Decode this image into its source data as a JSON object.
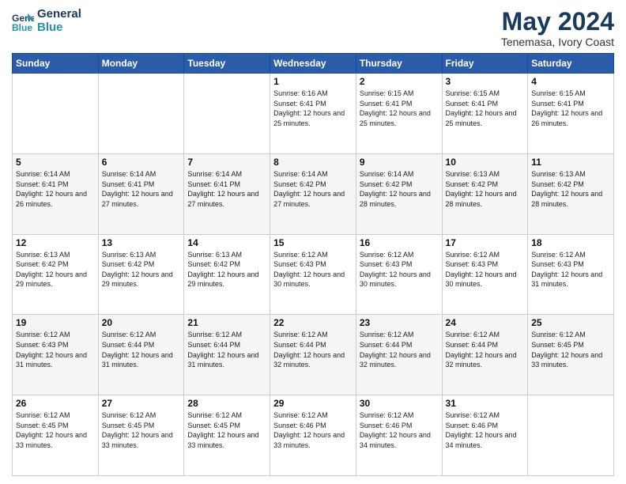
{
  "header": {
    "logo_line1": "General",
    "logo_line2": "Blue",
    "month_year": "May 2024",
    "location": "Tenemasa, Ivory Coast"
  },
  "days_of_week": [
    "Sunday",
    "Monday",
    "Tuesday",
    "Wednesday",
    "Thursday",
    "Friday",
    "Saturday"
  ],
  "weeks": [
    [
      {
        "num": "",
        "info": ""
      },
      {
        "num": "",
        "info": ""
      },
      {
        "num": "",
        "info": ""
      },
      {
        "num": "1",
        "info": "Sunrise: 6:16 AM\nSunset: 6:41 PM\nDaylight: 12 hours\nand 25 minutes."
      },
      {
        "num": "2",
        "info": "Sunrise: 6:15 AM\nSunset: 6:41 PM\nDaylight: 12 hours\nand 25 minutes."
      },
      {
        "num": "3",
        "info": "Sunrise: 6:15 AM\nSunset: 6:41 PM\nDaylight: 12 hours\nand 25 minutes."
      },
      {
        "num": "4",
        "info": "Sunrise: 6:15 AM\nSunset: 6:41 PM\nDaylight: 12 hours\nand 26 minutes."
      }
    ],
    [
      {
        "num": "5",
        "info": "Sunrise: 6:14 AM\nSunset: 6:41 PM\nDaylight: 12 hours\nand 26 minutes."
      },
      {
        "num": "6",
        "info": "Sunrise: 6:14 AM\nSunset: 6:41 PM\nDaylight: 12 hours\nand 27 minutes."
      },
      {
        "num": "7",
        "info": "Sunrise: 6:14 AM\nSunset: 6:41 PM\nDaylight: 12 hours\nand 27 minutes."
      },
      {
        "num": "8",
        "info": "Sunrise: 6:14 AM\nSunset: 6:42 PM\nDaylight: 12 hours\nand 27 minutes."
      },
      {
        "num": "9",
        "info": "Sunrise: 6:14 AM\nSunset: 6:42 PM\nDaylight: 12 hours\nand 28 minutes."
      },
      {
        "num": "10",
        "info": "Sunrise: 6:13 AM\nSunset: 6:42 PM\nDaylight: 12 hours\nand 28 minutes."
      },
      {
        "num": "11",
        "info": "Sunrise: 6:13 AM\nSunset: 6:42 PM\nDaylight: 12 hours\nand 28 minutes."
      }
    ],
    [
      {
        "num": "12",
        "info": "Sunrise: 6:13 AM\nSunset: 6:42 PM\nDaylight: 12 hours\nand 29 minutes."
      },
      {
        "num": "13",
        "info": "Sunrise: 6:13 AM\nSunset: 6:42 PM\nDaylight: 12 hours\nand 29 minutes."
      },
      {
        "num": "14",
        "info": "Sunrise: 6:13 AM\nSunset: 6:42 PM\nDaylight: 12 hours\nand 29 minutes."
      },
      {
        "num": "15",
        "info": "Sunrise: 6:12 AM\nSunset: 6:43 PM\nDaylight: 12 hours\nand 30 minutes."
      },
      {
        "num": "16",
        "info": "Sunrise: 6:12 AM\nSunset: 6:43 PM\nDaylight: 12 hours\nand 30 minutes."
      },
      {
        "num": "17",
        "info": "Sunrise: 6:12 AM\nSunset: 6:43 PM\nDaylight: 12 hours\nand 30 minutes."
      },
      {
        "num": "18",
        "info": "Sunrise: 6:12 AM\nSunset: 6:43 PM\nDaylight: 12 hours\nand 31 minutes."
      }
    ],
    [
      {
        "num": "19",
        "info": "Sunrise: 6:12 AM\nSunset: 6:43 PM\nDaylight: 12 hours\nand 31 minutes."
      },
      {
        "num": "20",
        "info": "Sunrise: 6:12 AM\nSunset: 6:44 PM\nDaylight: 12 hours\nand 31 minutes."
      },
      {
        "num": "21",
        "info": "Sunrise: 6:12 AM\nSunset: 6:44 PM\nDaylight: 12 hours\nand 31 minutes."
      },
      {
        "num": "22",
        "info": "Sunrise: 6:12 AM\nSunset: 6:44 PM\nDaylight: 12 hours\nand 32 minutes."
      },
      {
        "num": "23",
        "info": "Sunrise: 6:12 AM\nSunset: 6:44 PM\nDaylight: 12 hours\nand 32 minutes."
      },
      {
        "num": "24",
        "info": "Sunrise: 6:12 AM\nSunset: 6:44 PM\nDaylight: 12 hours\nand 32 minutes."
      },
      {
        "num": "25",
        "info": "Sunrise: 6:12 AM\nSunset: 6:45 PM\nDaylight: 12 hours\nand 33 minutes."
      }
    ],
    [
      {
        "num": "26",
        "info": "Sunrise: 6:12 AM\nSunset: 6:45 PM\nDaylight: 12 hours\nand 33 minutes."
      },
      {
        "num": "27",
        "info": "Sunrise: 6:12 AM\nSunset: 6:45 PM\nDaylight: 12 hours\nand 33 minutes."
      },
      {
        "num": "28",
        "info": "Sunrise: 6:12 AM\nSunset: 6:45 PM\nDaylight: 12 hours\nand 33 minutes."
      },
      {
        "num": "29",
        "info": "Sunrise: 6:12 AM\nSunset: 6:46 PM\nDaylight: 12 hours\nand 33 minutes."
      },
      {
        "num": "30",
        "info": "Sunrise: 6:12 AM\nSunset: 6:46 PM\nDaylight: 12 hours\nand 34 minutes."
      },
      {
        "num": "31",
        "info": "Sunrise: 6:12 AM\nSunset: 6:46 PM\nDaylight: 12 hours\nand 34 minutes."
      },
      {
        "num": "",
        "info": ""
      }
    ]
  ]
}
